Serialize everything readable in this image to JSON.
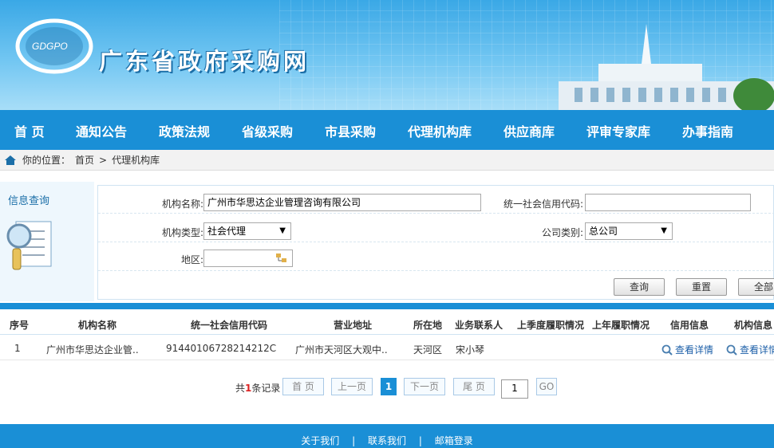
{
  "header": {
    "logo_text": "GDGPO",
    "site_title": "广东省政府采购网"
  },
  "nav": {
    "items": [
      {
        "label": "首 页"
      },
      {
        "label": "通知公告"
      },
      {
        "label": "政策法规"
      },
      {
        "label": "省级采购"
      },
      {
        "label": "市县采购"
      },
      {
        "label": "代理机构库"
      },
      {
        "label": "供应商库"
      },
      {
        "label": "评审专家库"
      },
      {
        "label": "办事指南"
      }
    ]
  },
  "breadcrumb": {
    "prefix": "你的位置：",
    "home": "首页",
    "separator": ">",
    "current": "代理机构库"
  },
  "query": {
    "title": "信息查询",
    "org_name_label": "机构名称:",
    "org_name_value": "广州市华思达企业管理咨询有限公司",
    "credit_code_label": "统一社会信用代码:",
    "credit_code_value": "",
    "org_type_label": "机构类型:",
    "org_type_value": "社会代理",
    "company_type_label": "公司类别:",
    "company_type_value": "总公司",
    "region_label": "地区:",
    "region_value": "",
    "query_button": "查询",
    "reset_button": "重置",
    "all_button": "全部"
  },
  "table": {
    "headers": [
      "序号",
      "机构名称",
      "统一社会信用代码",
      "营业地址",
      "所在地",
      "业务联系人",
      "上季度履职情况",
      "上年履职情况",
      "信用信息",
      "机构信息"
    ],
    "rows": [
      {
        "index": "1",
        "name": "广州市华思达企业管..",
        "credit_code": "91440106728214212C",
        "address": "广州市天河区大观中..",
        "location": "天河区",
        "contact": "宋小琴",
        "last_quarter": "",
        "last_year": "",
        "credit_info": "查看详情",
        "org_info": "查看详情"
      }
    ]
  },
  "pager": {
    "total_prefix": "共",
    "total_count": "1",
    "total_suffix": "条记录",
    "first": "首 页",
    "prev": "上一页",
    "current": "1",
    "next": "下一页",
    "last": "尾 页",
    "page_input": "1",
    "go": "GO"
  },
  "footer": {
    "about": "关于我们",
    "contact": "联系我们",
    "mail": "邮箱登录",
    "sep": "|"
  },
  "colors": {
    "primary": "#1a8fd6",
    "link": "#1c5fa8",
    "count_red": "#dd2222"
  }
}
